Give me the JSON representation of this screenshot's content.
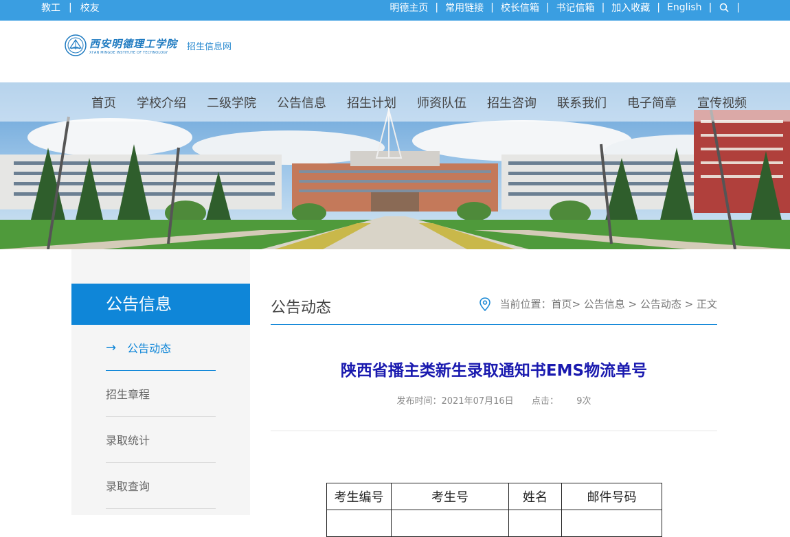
{
  "topbar": {
    "left": [
      "教工",
      "校友"
    ],
    "right": [
      "明德主页",
      "常用链接",
      "校长信箱",
      "书记信箱",
      "加入收藏",
      "English"
    ]
  },
  "header": {
    "logo_cn": "西安明德理工学院",
    "logo_en": "XI'AN MINGDE INSTITUTE OF TECHNOLOGY",
    "site_name": "招生信息网"
  },
  "nav": [
    "首页",
    "学校介绍",
    "二级学院",
    "公告信息",
    "招生计划",
    "师资队伍",
    "招生咨询",
    "联系我们",
    "电子简章",
    "宣传视频"
  ],
  "sidebar": {
    "title": "公告信息",
    "items": [
      "公告动态",
      "招生章程",
      "录取统计",
      "录取查询"
    ]
  },
  "main": {
    "section_title": "公告动态",
    "breadcrumb": "当前位置：首页> 公告信息 > 公告动态 > 正文"
  },
  "article": {
    "title": "陕西省播主类新生录取通知书EMS物流单号",
    "published_label": "发布时间：2021年07月16日",
    "clicks_label": "点击：",
    "clicks_value": "9次"
  },
  "table": {
    "headers": [
      "考生编号",
      "考生号",
      "姓名",
      "邮件号码"
    ]
  },
  "colors": {
    "topbar": "#3a9ee1",
    "accent": "#0f86d8",
    "article_title": "#1a1aaf"
  }
}
